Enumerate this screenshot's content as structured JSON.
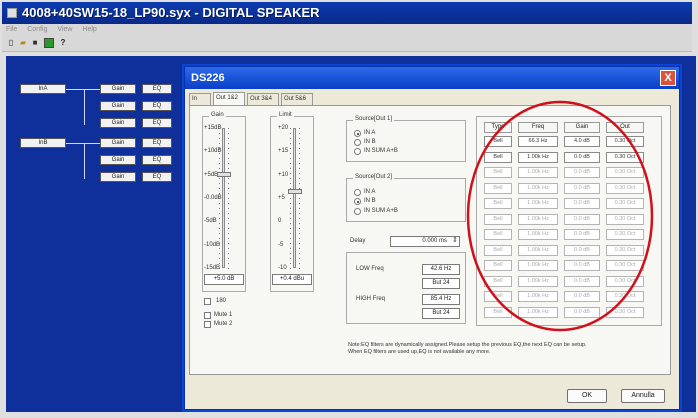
{
  "app": {
    "title": "4008+40SW15-18_LP90.syx - DIGITAL SPEAKER",
    "menu": [
      "File",
      "Config",
      "View",
      "Help"
    ]
  },
  "routing": {
    "inputs": [
      "InA",
      "InB"
    ],
    "gain_label": "Gain",
    "eq_label": "EQ"
  },
  "dialog": {
    "title": "DS226",
    "close": "X",
    "tabs": [
      "In",
      "Out 1&2",
      "Out 3&4",
      "Out 5&6"
    ],
    "gain": {
      "label": "Gain",
      "scale": [
        "+15dB",
        "+10dB",
        "+5dB",
        "-0.0dB",
        "-5dB",
        "-10dB",
        "-15dB"
      ],
      "value": "+5.0 dB",
      "level_fraction": 0.33
    },
    "limit": {
      "label": "Limit",
      "scale": [
        "+20",
        "+15",
        "+10",
        "+5",
        "0",
        "-5",
        "-10"
      ],
      "value": "+0.4 dBu",
      "level_fraction": 0.45
    },
    "check_180": "180",
    "mute1": "Mute 1",
    "mute2": "Mute 2",
    "source1": {
      "label": "Source[Out 1]",
      "options": [
        "IN A",
        "IN B",
        "IN SUM A+B"
      ],
      "selected": 0
    },
    "source2": {
      "label": "Source[Out 2]",
      "options": [
        "IN A",
        "IN B",
        "IN SUM A+B"
      ],
      "selected": 1
    },
    "delay": {
      "label": "Delay",
      "value": "0.000 ms"
    },
    "xover": {
      "low_label": "LOW Freq",
      "low_freq": "42.6 Hz",
      "low_type": "But 24",
      "high_label": "HIGH Freq",
      "high_freq": "85.4 Hz",
      "high_type": "But 24"
    },
    "eq": {
      "headers": [
        "Type",
        "Freq",
        "Gain",
        "Out"
      ],
      "rows": [
        {
          "type": "Bell",
          "freq": "66.3 Hz",
          "gain": "4.0 dB",
          "out": "0.30 Oct",
          "active": true
        },
        {
          "type": "Bell",
          "freq": "1.00k Hz",
          "gain": "0.0 dB",
          "out": "0.30 Oct",
          "active": true
        },
        {
          "type": "Bell",
          "freq": "1.00k Hz",
          "gain": "0.0 dB",
          "out": "0.30 Oct",
          "active": false
        },
        {
          "type": "Bell",
          "freq": "1.00k Hz",
          "gain": "0.0 dB",
          "out": "0.30 Oct",
          "active": false
        },
        {
          "type": "Bell",
          "freq": "1.00k Hz",
          "gain": "0.0 dB",
          "out": "0.30 Oct",
          "active": false
        },
        {
          "type": "Bell",
          "freq": "1.00k Hz",
          "gain": "0.0 dB",
          "out": "0.30 Oct",
          "active": false
        },
        {
          "type": "Bell",
          "freq": "1.00k Hz",
          "gain": "0.0 dB",
          "out": "0.30 Oct",
          "active": false
        },
        {
          "type": "Bell",
          "freq": "1.00k Hz",
          "gain": "0.0 dB",
          "out": "0.30 Oct",
          "active": false
        },
        {
          "type": "Bell",
          "freq": "1.00k Hz",
          "gain": "0.0 dB",
          "out": "0.30 Oct",
          "active": false
        },
        {
          "type": "Bell",
          "freq": "1.00k Hz",
          "gain": "0.0 dB",
          "out": "0.30 Oct",
          "active": false
        },
        {
          "type": "Bell",
          "freq": "1.00k Hz",
          "gain": "0.0 dB",
          "out": "0.30 Oct",
          "active": false
        },
        {
          "type": "Bell",
          "freq": "1.00k Hz",
          "gain": "0.0 dB",
          "out": "0.30 Oct",
          "active": false
        }
      ]
    },
    "note": "Note:EQ filters are dynamically assigned.Please setup the previous EQ,the next EQ can be setup.\nWhen EQ filters are used up,EQ is not available any more.",
    "ok": "OK",
    "cancel": "Annulla"
  },
  "colors": {
    "annotation_ellipse": "#d0101a",
    "canvas": "#0f2f9a"
  }
}
